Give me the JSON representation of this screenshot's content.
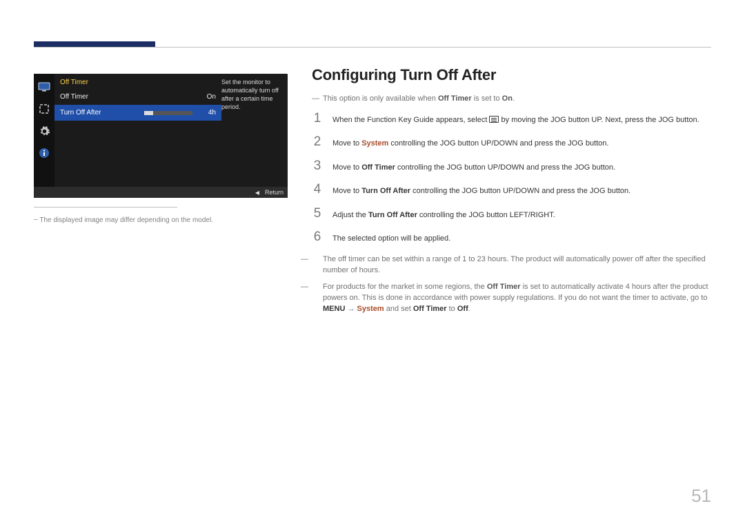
{
  "page_number": "51",
  "title": "Configuring Turn Off After",
  "osd": {
    "menu_title": "Off Timer",
    "rows": [
      {
        "label": "Off Timer",
        "value": "On",
        "selected": false,
        "has_slider": false
      },
      {
        "label": "Turn Off After",
        "value": "4h",
        "selected": true,
        "has_slider": true
      }
    ],
    "help_text": "Set the monitor to automatically turn off after a certain time period.",
    "return_label": "Return"
  },
  "osd_footnote": "The displayed image may differ depending on the model.",
  "intro_note": {
    "prefix": "This option is only available when ",
    "bold1": "Off Timer",
    "mid": " is set to ",
    "bold2": "On",
    "suffix": "."
  },
  "steps": {
    "s1a": "When the Function Key Guide appears, select ",
    "s1b": " by moving the JOG button UP. Next, press the JOG button.",
    "s2a": "Move to ",
    "s2_sys": "System",
    "s2b": " controlling the JOG button UP/DOWN and press the JOG button.",
    "s3a": "Move to ",
    "s3_bold": "Off Timer",
    "s3b": " controlling the JOG button UP/DOWN and press the JOG button.",
    "s4a": "Move to ",
    "s4_bold": "Turn Off After",
    "s4b": " controlling the JOG button UP/DOWN and press the JOG button.",
    "s5a": "Adjust the ",
    "s5_bold": "Turn Off After",
    "s5b": " controlling the JOG button LEFT/RIGHT.",
    "s6": "The selected option will be applied."
  },
  "foot1": "The off timer can be set within a range of 1 to 23 hours. The product will automatically power off after the specified number of hours.",
  "foot2": {
    "a": "For products for the market in some regions, the ",
    "b": "Off Timer",
    "c": " is set to automatically activate 4 hours after the product powers on. This is done in accordance with power supply regulations. If you do not want the timer to activate, go to ",
    "d": "MENU",
    "arrow": " → ",
    "e": "System",
    "f": " and set ",
    "g": "Off Timer",
    "h": " to ",
    "i": "Off",
    "j": "."
  }
}
